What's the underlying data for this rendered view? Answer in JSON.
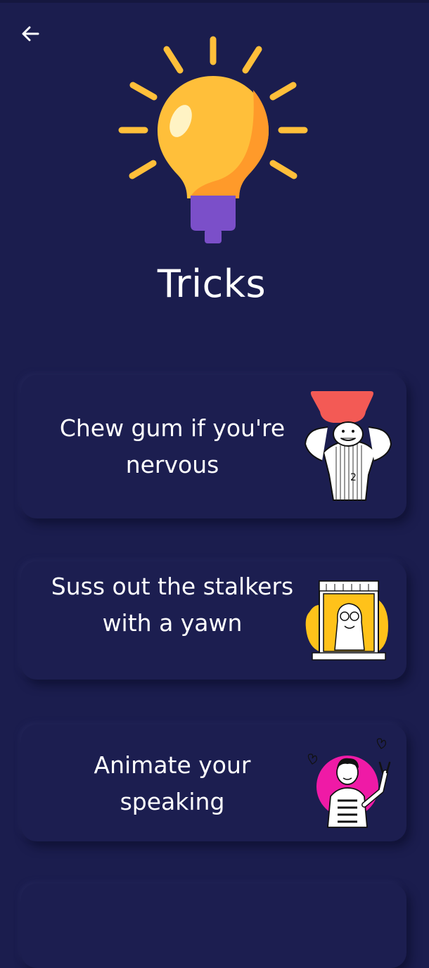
{
  "header": {
    "back_icon": "arrow-left-icon",
    "hero_icon": "lightbulb-icon",
    "title": "Tricks"
  },
  "colors": {
    "background": "#1b1d4e",
    "card": "#1c1e50",
    "bulb_yellow": "#ffbf3a",
    "bulb_base": "#7b4fc9",
    "accent_red": "#f35a55",
    "accent_yellow": "#ffc21a",
    "accent_pink": "#ef1aa6"
  },
  "tricks": [
    {
      "label": "Chew gum if you're nervous",
      "illustration": "nervous-player-illustration"
    },
    {
      "label": "Suss out the stalkers with a yawn",
      "illustration": "window-girl-illustration"
    },
    {
      "label": "Animate your speaking",
      "illustration": "peace-sign-man-illustration"
    }
  ]
}
